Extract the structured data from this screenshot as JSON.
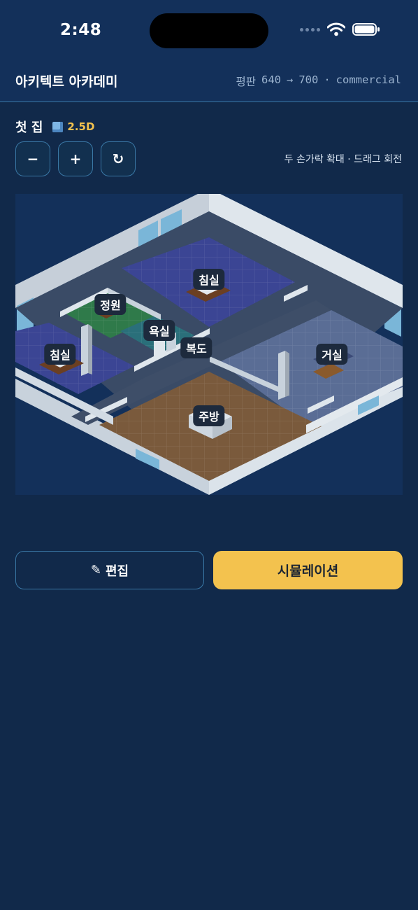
{
  "status": {
    "time": "2:48"
  },
  "header": {
    "title": "아키텍트 아카데미",
    "reputation_label": "평판",
    "reputation_from": "640",
    "reputation_arrow": "→",
    "reputation_to": "700",
    "separator": "·",
    "category": "commercial"
  },
  "house": {
    "name": "첫 집",
    "mode": "2.5D"
  },
  "controls": {
    "zoom_out": "−",
    "zoom_in": "+",
    "rotate": "↻",
    "hint": "두 손가락 확대 · 드래그 회전"
  },
  "rooms": [
    {
      "label": "침실"
    },
    {
      "label": "정원"
    },
    {
      "label": "욕실"
    },
    {
      "label": "복도"
    },
    {
      "label": "침실"
    },
    {
      "label": "거실"
    },
    {
      "label": "주방"
    }
  ],
  "actions": {
    "edit_icon": "✎",
    "edit_label": "편집",
    "simulate_label": "시뮬레이션"
  },
  "colors": {
    "accent": "#f3c24e",
    "background": "#11294a",
    "border": "#3a78a6",
    "bedroom_floor": "#3b4594",
    "garden_floor": "#2f7a4a",
    "bathroom_floor": "#2a6f7a",
    "living_floor": "#5a6d95",
    "kitchen_floor": "#7a5a3c",
    "corridor_floor": "#3e4e68"
  }
}
